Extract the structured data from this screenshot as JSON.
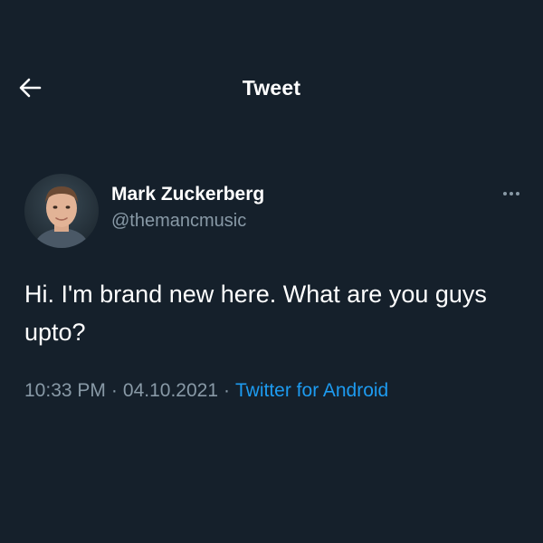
{
  "header": {
    "title": "Tweet",
    "back_icon": "arrow-left-icon"
  },
  "tweet": {
    "author": {
      "display_name": "Mark Zuckerberg",
      "handle": "@themancmusic"
    },
    "text": "Hi. I'm brand new here. What are you guys upto?",
    "time": "10:33 PM",
    "separator": "·",
    "date": "04.10.2021",
    "source": "Twitter for Android",
    "more_icon": "more-horizontal-icon"
  },
  "colors": {
    "background": "#15202b",
    "primary_text": "#ffffff",
    "secondary_text": "#8899a6",
    "link": "#1d9bf0"
  }
}
